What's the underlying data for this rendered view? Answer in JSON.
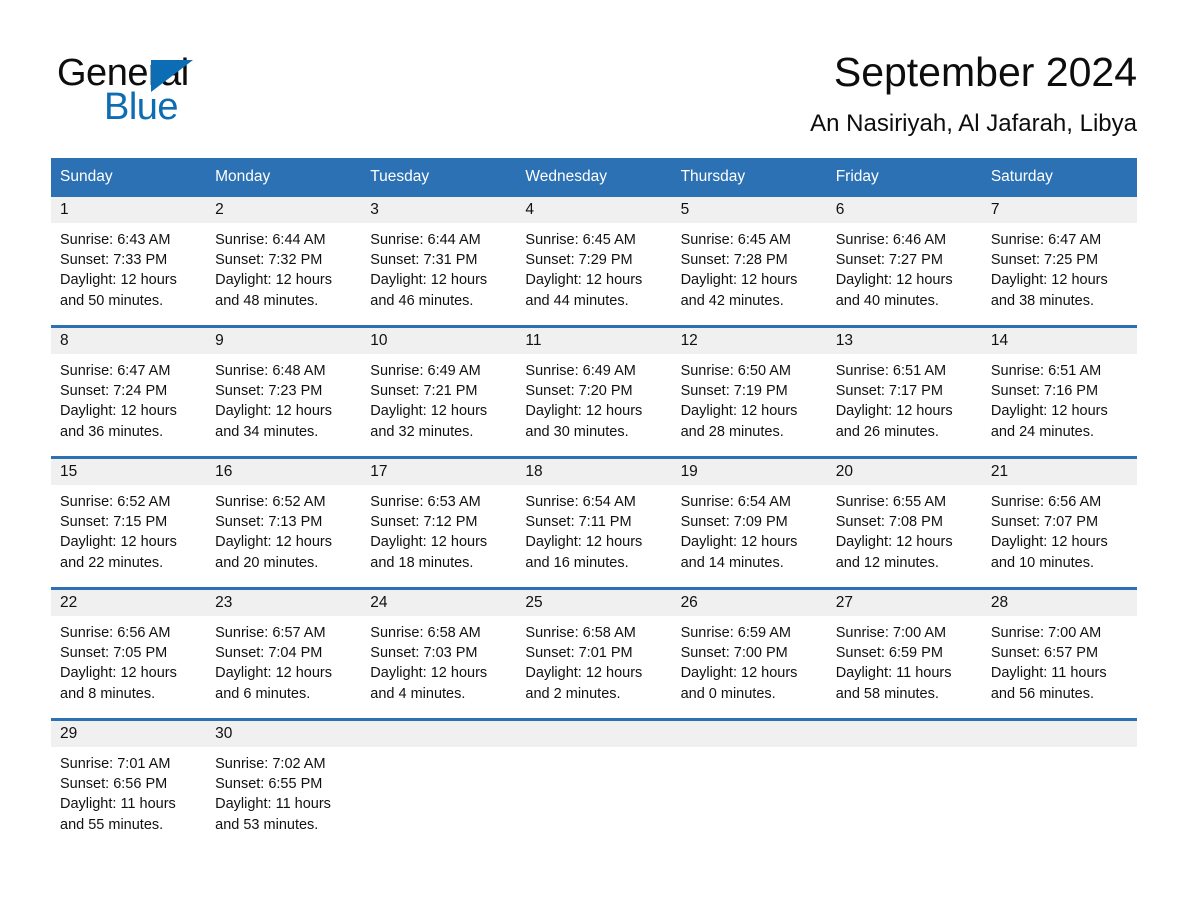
{
  "brand": {
    "name_top": "General",
    "name_bottom": "Blue",
    "color_black": "#0d0d0d",
    "color_blue": "#0c6cb4"
  },
  "header": {
    "title": "September 2024",
    "subtitle": "An Nasiriyah, Al Jafarah, Libya"
  },
  "theme": {
    "header_blue": "#2b71b3",
    "daynum_band": "#f0f0f0",
    "text": "#111111"
  },
  "weekdays": [
    "Sunday",
    "Monday",
    "Tuesday",
    "Wednesday",
    "Thursday",
    "Friday",
    "Saturday"
  ],
  "weeks": [
    [
      {
        "day": "1",
        "sunrise": "Sunrise: 6:43 AM",
        "sunset": "Sunset: 7:33 PM",
        "daylight": "Daylight: 12 hours and 50 minutes."
      },
      {
        "day": "2",
        "sunrise": "Sunrise: 6:44 AM",
        "sunset": "Sunset: 7:32 PM",
        "daylight": "Daylight: 12 hours and 48 minutes."
      },
      {
        "day": "3",
        "sunrise": "Sunrise: 6:44 AM",
        "sunset": "Sunset: 7:31 PM",
        "daylight": "Daylight: 12 hours and 46 minutes."
      },
      {
        "day": "4",
        "sunrise": "Sunrise: 6:45 AM",
        "sunset": "Sunset: 7:29 PM",
        "daylight": "Daylight: 12 hours and 44 minutes."
      },
      {
        "day": "5",
        "sunrise": "Sunrise: 6:45 AM",
        "sunset": "Sunset: 7:28 PM",
        "daylight": "Daylight: 12 hours and 42 minutes."
      },
      {
        "day": "6",
        "sunrise": "Sunrise: 6:46 AM",
        "sunset": "Sunset: 7:27 PM",
        "daylight": "Daylight: 12 hours and 40 minutes."
      },
      {
        "day": "7",
        "sunrise": "Sunrise: 6:47 AM",
        "sunset": "Sunset: 7:25 PM",
        "daylight": "Daylight: 12 hours and 38 minutes."
      }
    ],
    [
      {
        "day": "8",
        "sunrise": "Sunrise: 6:47 AM",
        "sunset": "Sunset: 7:24 PM",
        "daylight": "Daylight: 12 hours and 36 minutes."
      },
      {
        "day": "9",
        "sunrise": "Sunrise: 6:48 AM",
        "sunset": "Sunset: 7:23 PM",
        "daylight": "Daylight: 12 hours and 34 minutes."
      },
      {
        "day": "10",
        "sunrise": "Sunrise: 6:49 AM",
        "sunset": "Sunset: 7:21 PM",
        "daylight": "Daylight: 12 hours and 32 minutes."
      },
      {
        "day": "11",
        "sunrise": "Sunrise: 6:49 AM",
        "sunset": "Sunset: 7:20 PM",
        "daylight": "Daylight: 12 hours and 30 minutes."
      },
      {
        "day": "12",
        "sunrise": "Sunrise: 6:50 AM",
        "sunset": "Sunset: 7:19 PM",
        "daylight": "Daylight: 12 hours and 28 minutes."
      },
      {
        "day": "13",
        "sunrise": "Sunrise: 6:51 AM",
        "sunset": "Sunset: 7:17 PM",
        "daylight": "Daylight: 12 hours and 26 minutes."
      },
      {
        "day": "14",
        "sunrise": "Sunrise: 6:51 AM",
        "sunset": "Sunset: 7:16 PM",
        "daylight": "Daylight: 12 hours and 24 minutes."
      }
    ],
    [
      {
        "day": "15",
        "sunrise": "Sunrise: 6:52 AM",
        "sunset": "Sunset: 7:15 PM",
        "daylight": "Daylight: 12 hours and 22 minutes."
      },
      {
        "day": "16",
        "sunrise": "Sunrise: 6:52 AM",
        "sunset": "Sunset: 7:13 PM",
        "daylight": "Daylight: 12 hours and 20 minutes."
      },
      {
        "day": "17",
        "sunrise": "Sunrise: 6:53 AM",
        "sunset": "Sunset: 7:12 PM",
        "daylight": "Daylight: 12 hours and 18 minutes."
      },
      {
        "day": "18",
        "sunrise": "Sunrise: 6:54 AM",
        "sunset": "Sunset: 7:11 PM",
        "daylight": "Daylight: 12 hours and 16 minutes."
      },
      {
        "day": "19",
        "sunrise": "Sunrise: 6:54 AM",
        "sunset": "Sunset: 7:09 PM",
        "daylight": "Daylight: 12 hours and 14 minutes."
      },
      {
        "day": "20",
        "sunrise": "Sunrise: 6:55 AM",
        "sunset": "Sunset: 7:08 PM",
        "daylight": "Daylight: 12 hours and 12 minutes."
      },
      {
        "day": "21",
        "sunrise": "Sunrise: 6:56 AM",
        "sunset": "Sunset: 7:07 PM",
        "daylight": "Daylight: 12 hours and 10 minutes."
      }
    ],
    [
      {
        "day": "22",
        "sunrise": "Sunrise: 6:56 AM",
        "sunset": "Sunset: 7:05 PM",
        "daylight": "Daylight: 12 hours and 8 minutes."
      },
      {
        "day": "23",
        "sunrise": "Sunrise: 6:57 AM",
        "sunset": "Sunset: 7:04 PM",
        "daylight": "Daylight: 12 hours and 6 minutes."
      },
      {
        "day": "24",
        "sunrise": "Sunrise: 6:58 AM",
        "sunset": "Sunset: 7:03 PM",
        "daylight": "Daylight: 12 hours and 4 minutes."
      },
      {
        "day": "25",
        "sunrise": "Sunrise: 6:58 AM",
        "sunset": "Sunset: 7:01 PM",
        "daylight": "Daylight: 12 hours and 2 minutes."
      },
      {
        "day": "26",
        "sunrise": "Sunrise: 6:59 AM",
        "sunset": "Sunset: 7:00 PM",
        "daylight": "Daylight: 12 hours and 0 minutes."
      },
      {
        "day": "27",
        "sunrise": "Sunrise: 7:00 AM",
        "sunset": "Sunset: 6:59 PM",
        "daylight": "Daylight: 11 hours and 58 minutes."
      },
      {
        "day": "28",
        "sunrise": "Sunrise: 7:00 AM",
        "sunset": "Sunset: 6:57 PM",
        "daylight": "Daylight: 11 hours and 56 minutes."
      }
    ],
    [
      {
        "day": "29",
        "sunrise": "Sunrise: 7:01 AM",
        "sunset": "Sunset: 6:56 PM",
        "daylight": "Daylight: 11 hours and 55 minutes."
      },
      {
        "day": "30",
        "sunrise": "Sunrise: 7:02 AM",
        "sunset": "Sunset: 6:55 PM",
        "daylight": "Daylight: 11 hours and 53 minutes."
      },
      {
        "day": "",
        "sunrise": "",
        "sunset": "",
        "daylight": ""
      },
      {
        "day": "",
        "sunrise": "",
        "sunset": "",
        "daylight": ""
      },
      {
        "day": "",
        "sunrise": "",
        "sunset": "",
        "daylight": ""
      },
      {
        "day": "",
        "sunrise": "",
        "sunset": "",
        "daylight": ""
      },
      {
        "day": "",
        "sunrise": "",
        "sunset": "",
        "daylight": ""
      }
    ]
  ]
}
